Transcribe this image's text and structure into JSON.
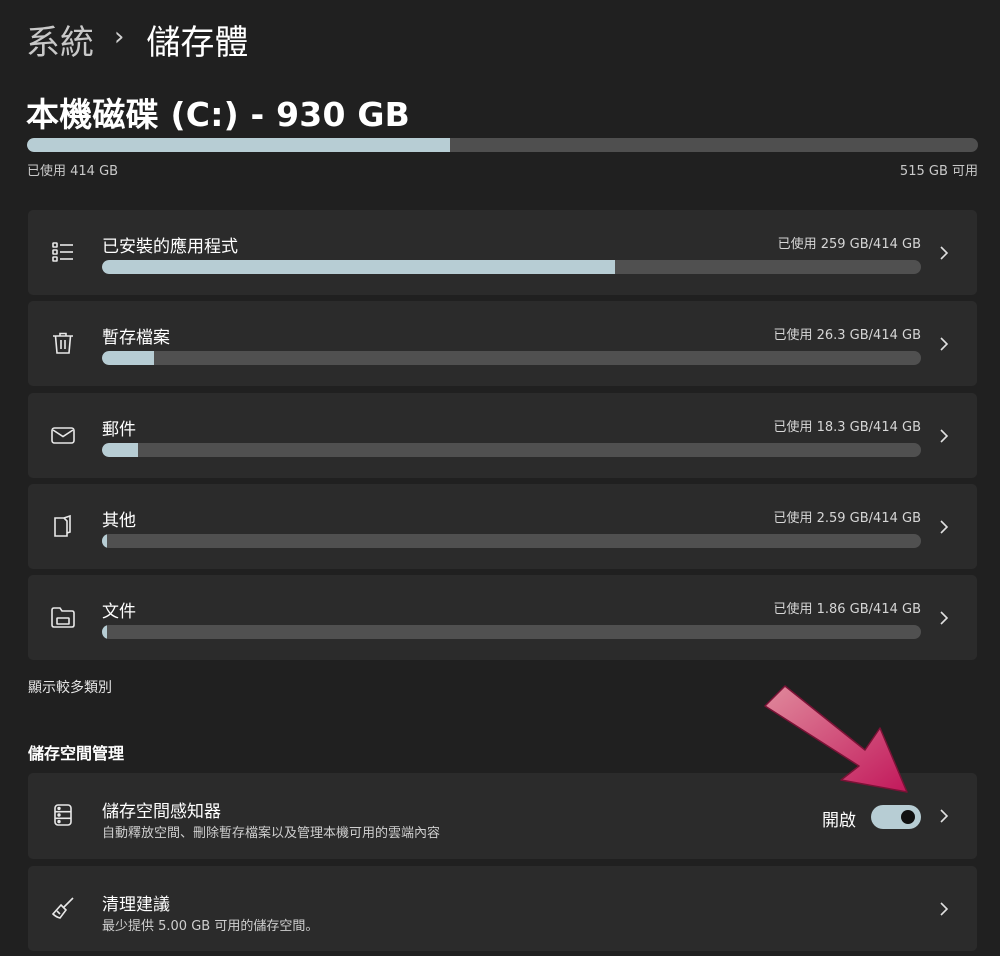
{
  "breadcrumb": {
    "parent": "系統",
    "separator": "›",
    "current": "儲存體"
  },
  "drive": {
    "title": "本機磁碟 (C:) - 930 GB",
    "used_label": "已使用 414 GB",
    "free_label": "515 GB 可用",
    "used_fraction": 0.445
  },
  "categories": [
    {
      "icon": "list-icon",
      "title": "已安裝的應用程式",
      "usage": "已使用 259 GB/414 GB",
      "fraction": 0.626
    },
    {
      "icon": "trash-icon",
      "title": "暫存檔案",
      "usage": "已使用 26.3 GB/414 GB",
      "fraction": 0.064
    },
    {
      "icon": "mail-icon",
      "title": "郵件",
      "usage": "已使用 18.3 GB/414 GB",
      "fraction": 0.044
    },
    {
      "icon": "document-icon",
      "title": "其他",
      "usage": "已使用 2.59 GB/414 GB",
      "fraction": 0.006
    },
    {
      "icon": "folder-icon",
      "title": "文件",
      "usage": "已使用 1.86 GB/414 GB",
      "fraction": 0.0045
    }
  ],
  "show_more": "顯示較多類別",
  "management": {
    "heading": "儲存空間管理",
    "storage_sense": {
      "icon": "storage-icon",
      "title": "儲存空間感知器",
      "description": "自動釋放空間、刪除暫存檔案以及管理本機可用的雲端內容",
      "toggle_label": "開啟",
      "toggle_on": true
    },
    "cleanup": {
      "icon": "broom-icon",
      "title": "清理建議",
      "description": "最少提供 5.00 GB 可用的儲存空間。"
    }
  },
  "colors": {
    "background": "#202020",
    "card": "#2b2b2b",
    "accent": "#b7cdd4",
    "track": "#505050",
    "annotation_arrow": "#c2185b"
  }
}
